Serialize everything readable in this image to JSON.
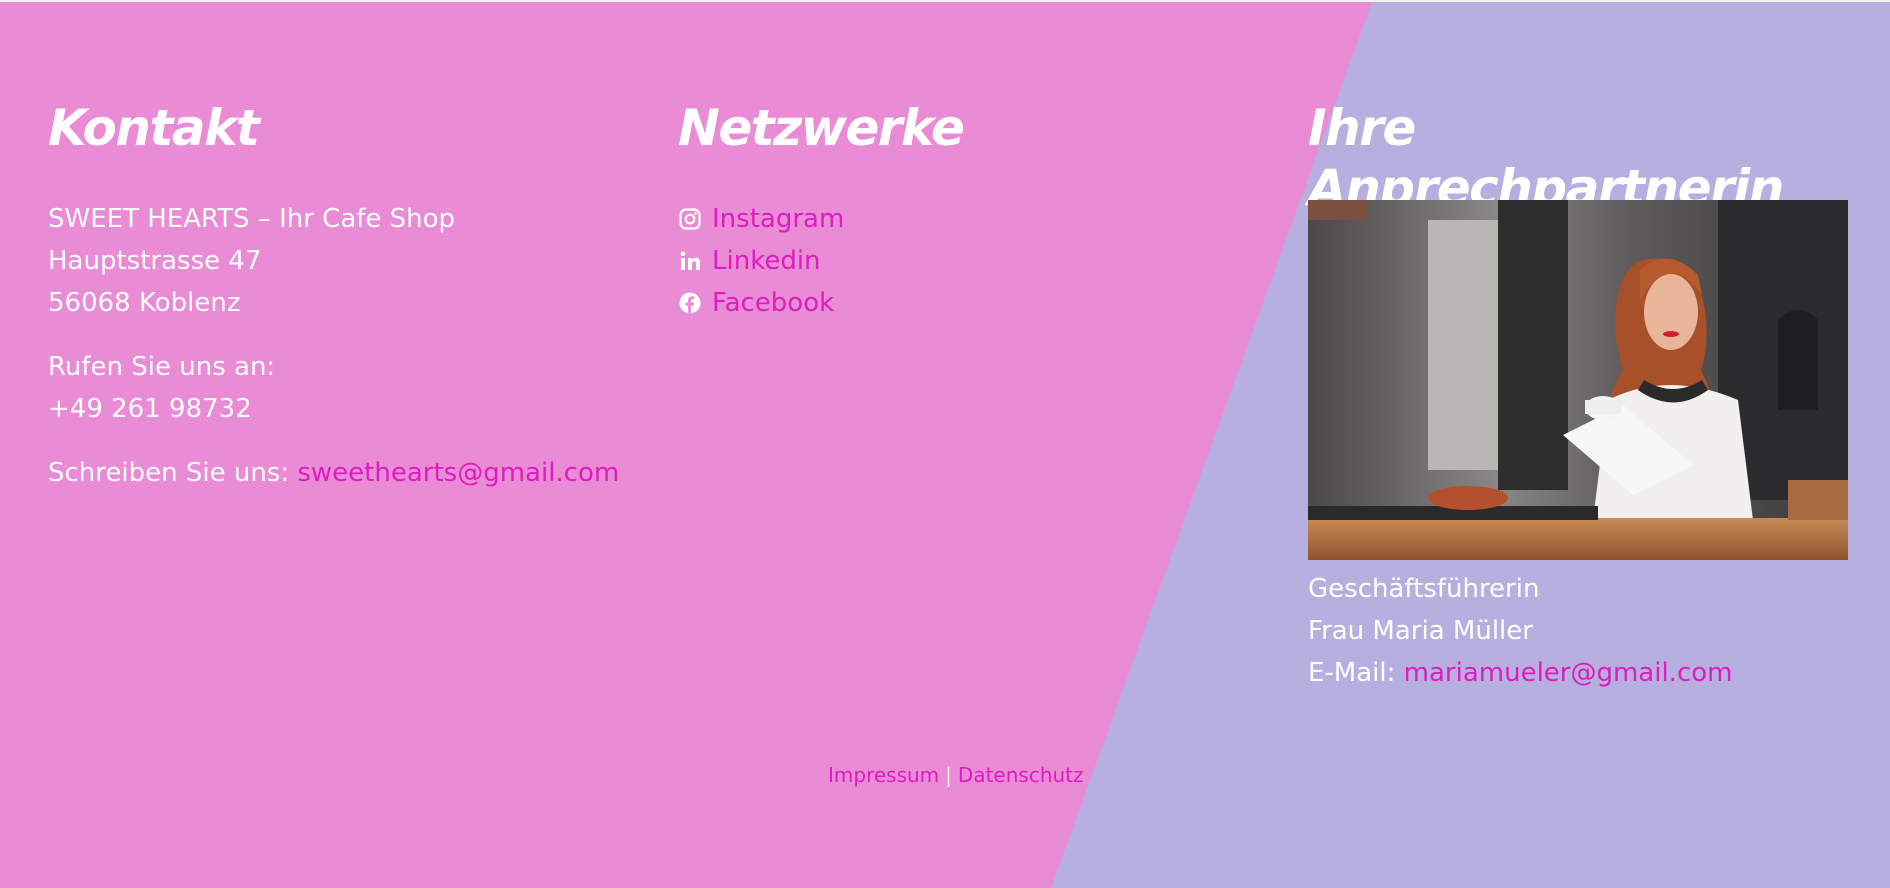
{
  "kontakt": {
    "heading": "Kontakt",
    "company": "SWEET HEARTS – Ihr Cafe Shop",
    "street": "Hauptstrasse 47",
    "city": "56068 Koblenz",
    "call_label": "Rufen Sie uns an:",
    "phone": "+49 261 98732",
    "write_label": "Schreiben Sie uns:",
    "email": "sweethearts@gmail.com"
  },
  "netzwerke": {
    "heading": "Netzwerke",
    "items": [
      {
        "label": "Instagram",
        "icon": "instagram-icon"
      },
      {
        "label": "Linkedin",
        "icon": "linkedin-icon"
      },
      {
        "label": "Facebook",
        "icon": "facebook-icon"
      }
    ]
  },
  "ansprechpartnerin": {
    "heading": "Ihre Anprechpartnerin",
    "role": "Geschäftsführerin",
    "name": "Frau Maria Müller",
    "email_label": "E-Mail:",
    "email": "mariamueler@gmail.com"
  },
  "legal": {
    "impressum": "Impressum",
    "separator": "|",
    "datenschutz": "Datenschutz"
  },
  "colors": {
    "pink_background": "#ea8bd6",
    "lavender_background": "#b7afe0",
    "link_accent": "#e01bc0",
    "text": "#ffffff"
  }
}
